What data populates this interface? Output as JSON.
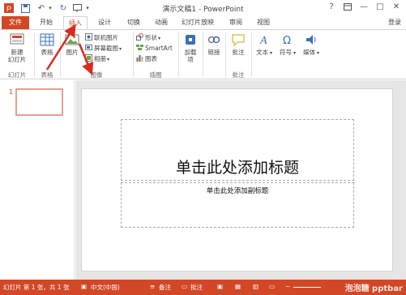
{
  "titlebar": {
    "title": "演示文稿1 - PowerPoint",
    "help": "?",
    "minimize": "—",
    "restore": "□",
    "close": "✕"
  },
  "tabs": [
    "文件",
    "开始",
    "插入",
    "设计",
    "切换",
    "动画",
    "幻灯片放映",
    "审阅",
    "视图"
  ],
  "login": "登录",
  "ribbon": {
    "new_slide": "新建\n幻灯片",
    "table": "表格",
    "picture": "图片",
    "online_picture": "联机图片",
    "screenshot": "屏幕截图",
    "album": "相册",
    "shapes": "形状",
    "smartart": "SmartArt",
    "chart": "图表",
    "addins": "加载\n项",
    "link": "链接",
    "comment": "批注",
    "text": "文本",
    "symbol": "符号",
    "media": "媒体",
    "groups": {
      "slides": "幻灯片",
      "tables": "表格",
      "images": "图像",
      "illustrations": "插图",
      "comments": "批注"
    }
  },
  "slide_panel": {
    "number": "1"
  },
  "slide": {
    "title_placeholder": "单击此处添加标题",
    "subtitle_placeholder": "单击此处添加副标题"
  },
  "status": {
    "slide_info": "幻灯片 第 1 张，共 1 张",
    "language": "中文(中国)",
    "notes": "备注",
    "comments": "批注"
  },
  "watermark": "泡泡糖 pptbar"
}
